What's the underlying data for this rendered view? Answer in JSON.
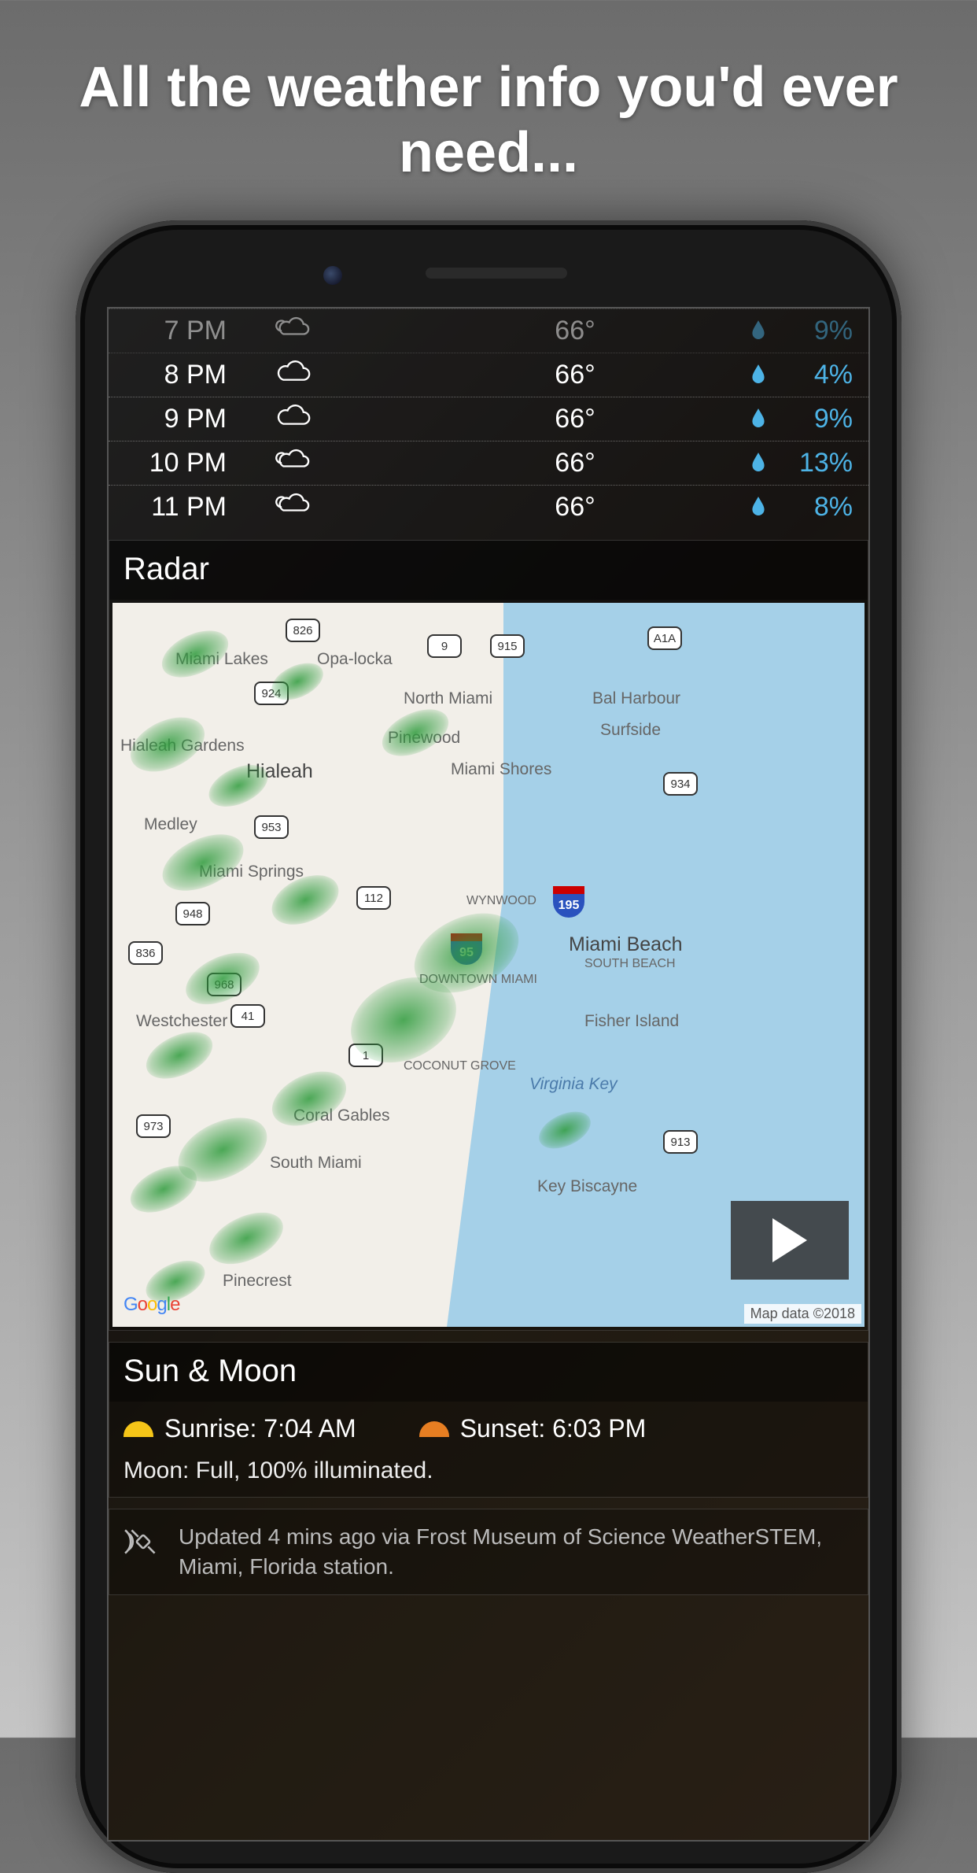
{
  "promo": {
    "headline": "All the weather info you'd ever need..."
  },
  "hourly": [
    {
      "time": "7 PM",
      "icon": "partly-cloudy-night",
      "temp": "66°",
      "precip": "9%"
    },
    {
      "time": "8 PM",
      "icon": "cloudy",
      "temp": "66°",
      "precip": "4%"
    },
    {
      "time": "9 PM",
      "icon": "cloudy",
      "temp": "66°",
      "precip": "9%"
    },
    {
      "time": "10 PM",
      "icon": "partly-cloudy-night",
      "temp": "66°",
      "precip": "13%"
    },
    {
      "time": "11 PM",
      "icon": "partly-cloudy-night",
      "temp": "66°",
      "precip": "8%"
    }
  ],
  "radar": {
    "title": "Radar",
    "attribution_logo": "Google",
    "attribution_text": "Map data ©2018",
    "map_labels": [
      "Miami Lakes",
      "Opa-locka",
      "North Miami",
      "Bal Harbour",
      "Hialeah Gardens",
      "Hialeah",
      "Pinewood",
      "Miami Shores",
      "Surfside",
      "Medley",
      "Miami Springs",
      "WYNWOOD",
      "Miami Beach",
      "SOUTH BEACH",
      "DOWNTOWN MIAMI",
      "Westchester",
      "Fisher Island",
      "COCONUT GROVE",
      "Virginia Key",
      "Coral Gables",
      "South Miami",
      "Key Biscayne",
      "Pinecrest"
    ],
    "highways": [
      "826",
      "924",
      "9",
      "915",
      "A1A",
      "953",
      "934",
      "112",
      "195",
      "948",
      "95",
      "836",
      "968",
      "41",
      "1",
      "973",
      "913"
    ]
  },
  "sun_moon": {
    "title": "Sun & Moon",
    "sunrise_label": "Sunrise: 7:04 AM",
    "sunset_label": "Sunset: 6:03 PM",
    "moon_text": "Moon: Full, 100% illuminated."
  },
  "update": {
    "text": "Updated 4 mins ago via Frost Museum of Science WeatherSTEM, Miami, Florida station."
  }
}
